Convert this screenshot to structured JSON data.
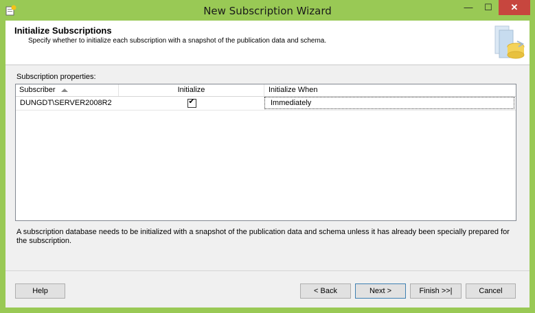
{
  "window": {
    "title": "New Subscription Wizard",
    "minimize_glyph": "—",
    "maximize_glyph": "☐",
    "close_glyph": "✕"
  },
  "header": {
    "title": "Initialize Subscriptions",
    "subtitle": "Specify whether to initialize each subscription with a snapshot of the publication data and schema."
  },
  "properties": {
    "label": "Subscription properties:",
    "columns": [
      "Subscriber",
      "Initialize",
      "Initialize When"
    ],
    "rows": [
      {
        "subscriber": "DUNGDT\\SERVER2008R2",
        "initialize": true,
        "check_glyph": "✔",
        "initialize_when": "Immediately"
      }
    ]
  },
  "description": "A subscription database needs to be initialized with a snapshot of the publication data and schema unless it has already been specially prepared for the subscription.",
  "buttons": {
    "help": "Help",
    "back": "< Back",
    "next": "Next >",
    "finish": "Finish >>|",
    "cancel": "Cancel"
  },
  "colors": {
    "frame": "#99c955",
    "close_button": "#c7463e",
    "panel": "#f0f0f0"
  }
}
